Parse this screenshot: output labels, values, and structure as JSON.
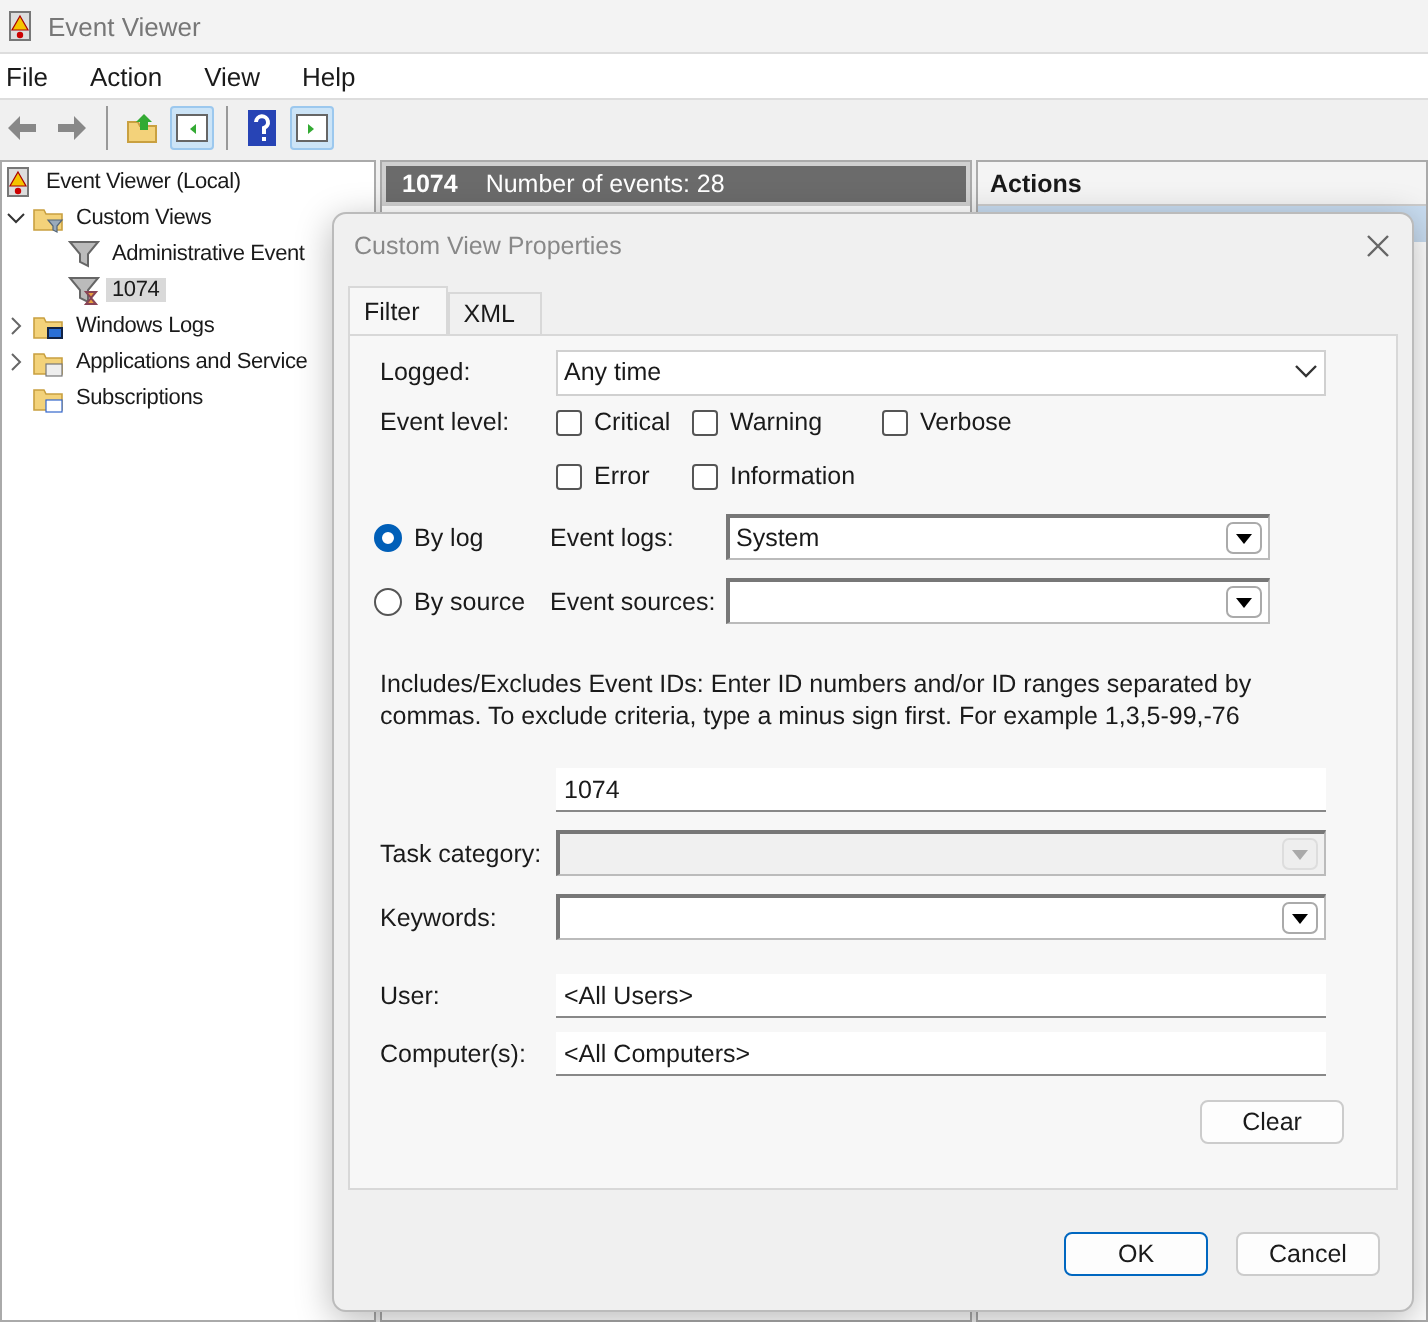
{
  "window": {
    "title": "Event Viewer"
  },
  "menu": [
    "File",
    "Action",
    "View",
    "Help"
  ],
  "toolbar": [
    {
      "kind": "back"
    },
    {
      "kind": "forward"
    },
    {
      "kind": "sep"
    },
    {
      "kind": "folder-up"
    },
    {
      "kind": "pane-left",
      "selected": true
    },
    {
      "kind": "sep"
    },
    {
      "kind": "help"
    },
    {
      "kind": "pane-right",
      "selected": true
    }
  ],
  "tree": [
    {
      "label": "Event Viewer (Local)",
      "kind": "viewer",
      "selected": false,
      "children": [
        {
          "label": "Custom Views",
          "kind": "folder-filter",
          "expanded": true,
          "selected": false,
          "children": [
            {
              "label": "Administrative Event",
              "kind": "filter",
              "selected": false
            },
            {
              "label": "1074",
              "kind": "filter-clock",
              "selected": true
            }
          ]
        },
        {
          "label": "Windows Logs",
          "kind": "folder-monitor",
          "expanded": false,
          "selected": false
        },
        {
          "label": "Applications and Service",
          "kind": "folder-box",
          "expanded": false,
          "selected": false
        },
        {
          "label": "Subscriptions",
          "kind": "folder-sub",
          "selected": false
        }
      ]
    }
  ],
  "middle": {
    "name": "1074",
    "count": "Number of events: 28"
  },
  "actions": {
    "title": "Actions"
  },
  "dialog": {
    "title": "Custom View Properties",
    "tabs": [
      {
        "label": "Filter",
        "selected": true
      },
      {
        "label": "XML",
        "selected": false
      }
    ],
    "logged": {
      "label": "Logged:",
      "value": "Any time"
    },
    "event_level": {
      "label": "Event level:",
      "options": [
        {
          "label": "Critical",
          "checked": false
        },
        {
          "label": "Warning",
          "checked": false
        },
        {
          "label": "Verbose",
          "checked": false
        },
        {
          "label": "Error",
          "checked": false
        },
        {
          "label": "Information",
          "checked": false
        }
      ]
    },
    "sources": [
      {
        "label": "By log",
        "selected": true,
        "field_label": "Event logs:",
        "value": "System"
      },
      {
        "label": "By source",
        "selected": false,
        "field_label": "Event sources:"
      }
    ],
    "ids_help": "Includes/Excludes Event IDs: Enter ID numbers and/or ID ranges separated by commas. To exclude criteria, type a minus sign first. For example 1,3,5-99,-76",
    "ids_value": "1074",
    "task_category": {
      "label": "Task category:",
      "disabled": true
    },
    "keywords": {
      "label": "Keywords:",
      "disabled": false
    },
    "user": {
      "label": "User:",
      "value": "<All Users>"
    },
    "computers": {
      "label": "Computer(s):",
      "value": "<All Computers>"
    },
    "clear": "Clear",
    "buttons": [
      {
        "label": "OK",
        "default": true
      },
      {
        "label": "Cancel",
        "default": false
      }
    ]
  }
}
